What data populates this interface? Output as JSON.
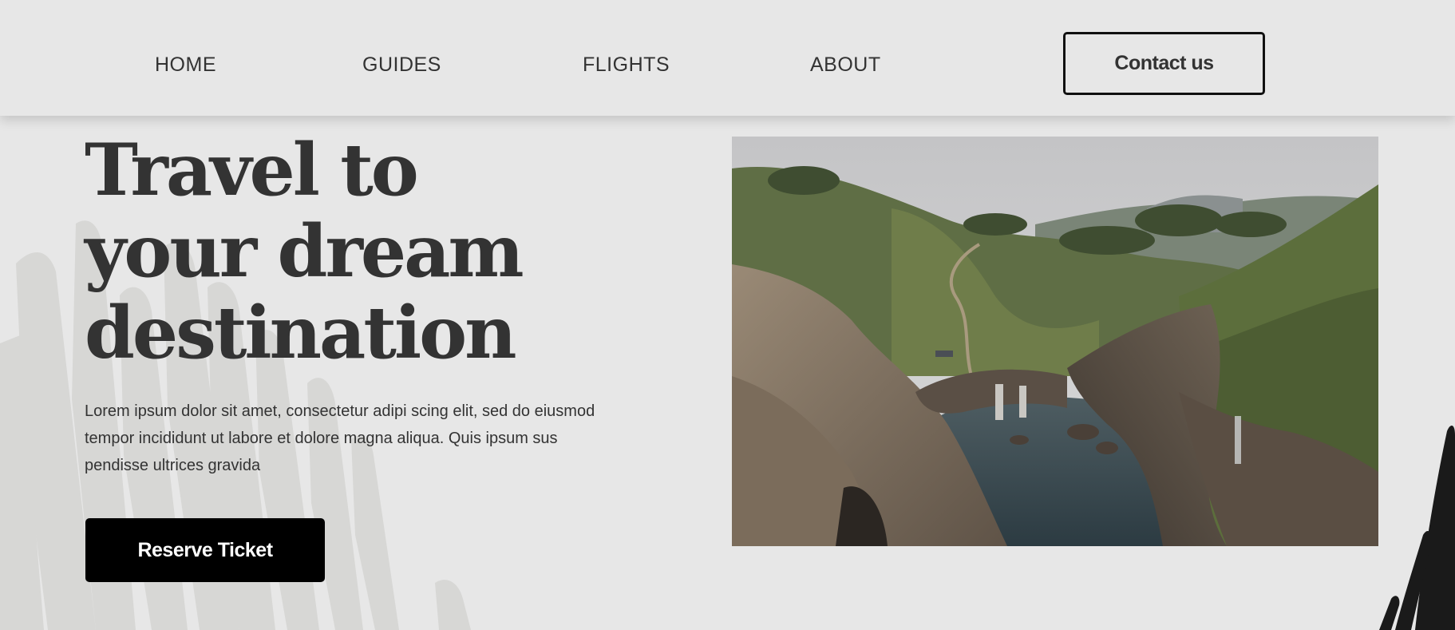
{
  "nav": {
    "items": [
      {
        "label": "HOME"
      },
      {
        "label": "GUIDES"
      },
      {
        "label": "FLIGHTS"
      },
      {
        "label": "ABOUT"
      }
    ],
    "contact_label": "Contact us"
  },
  "hero": {
    "title_lines": [
      "Travel to",
      "your dream",
      "destination"
    ],
    "description": "Lorem ipsum dolor sit amet, consectetur adipi scing elit, sed do eiusmod tempor incididunt ut labore et dolore magna aliqua. Quis ipsum sus pendisse ultrices gravida",
    "cta_label": "Reserve Ticket",
    "image_icon": "coastal-landscape-photo"
  },
  "colors": {
    "background": "#e7e7e7",
    "text": "#333333",
    "button_dark": "#000000",
    "button_text": "#ffffff",
    "border": "#111111"
  }
}
